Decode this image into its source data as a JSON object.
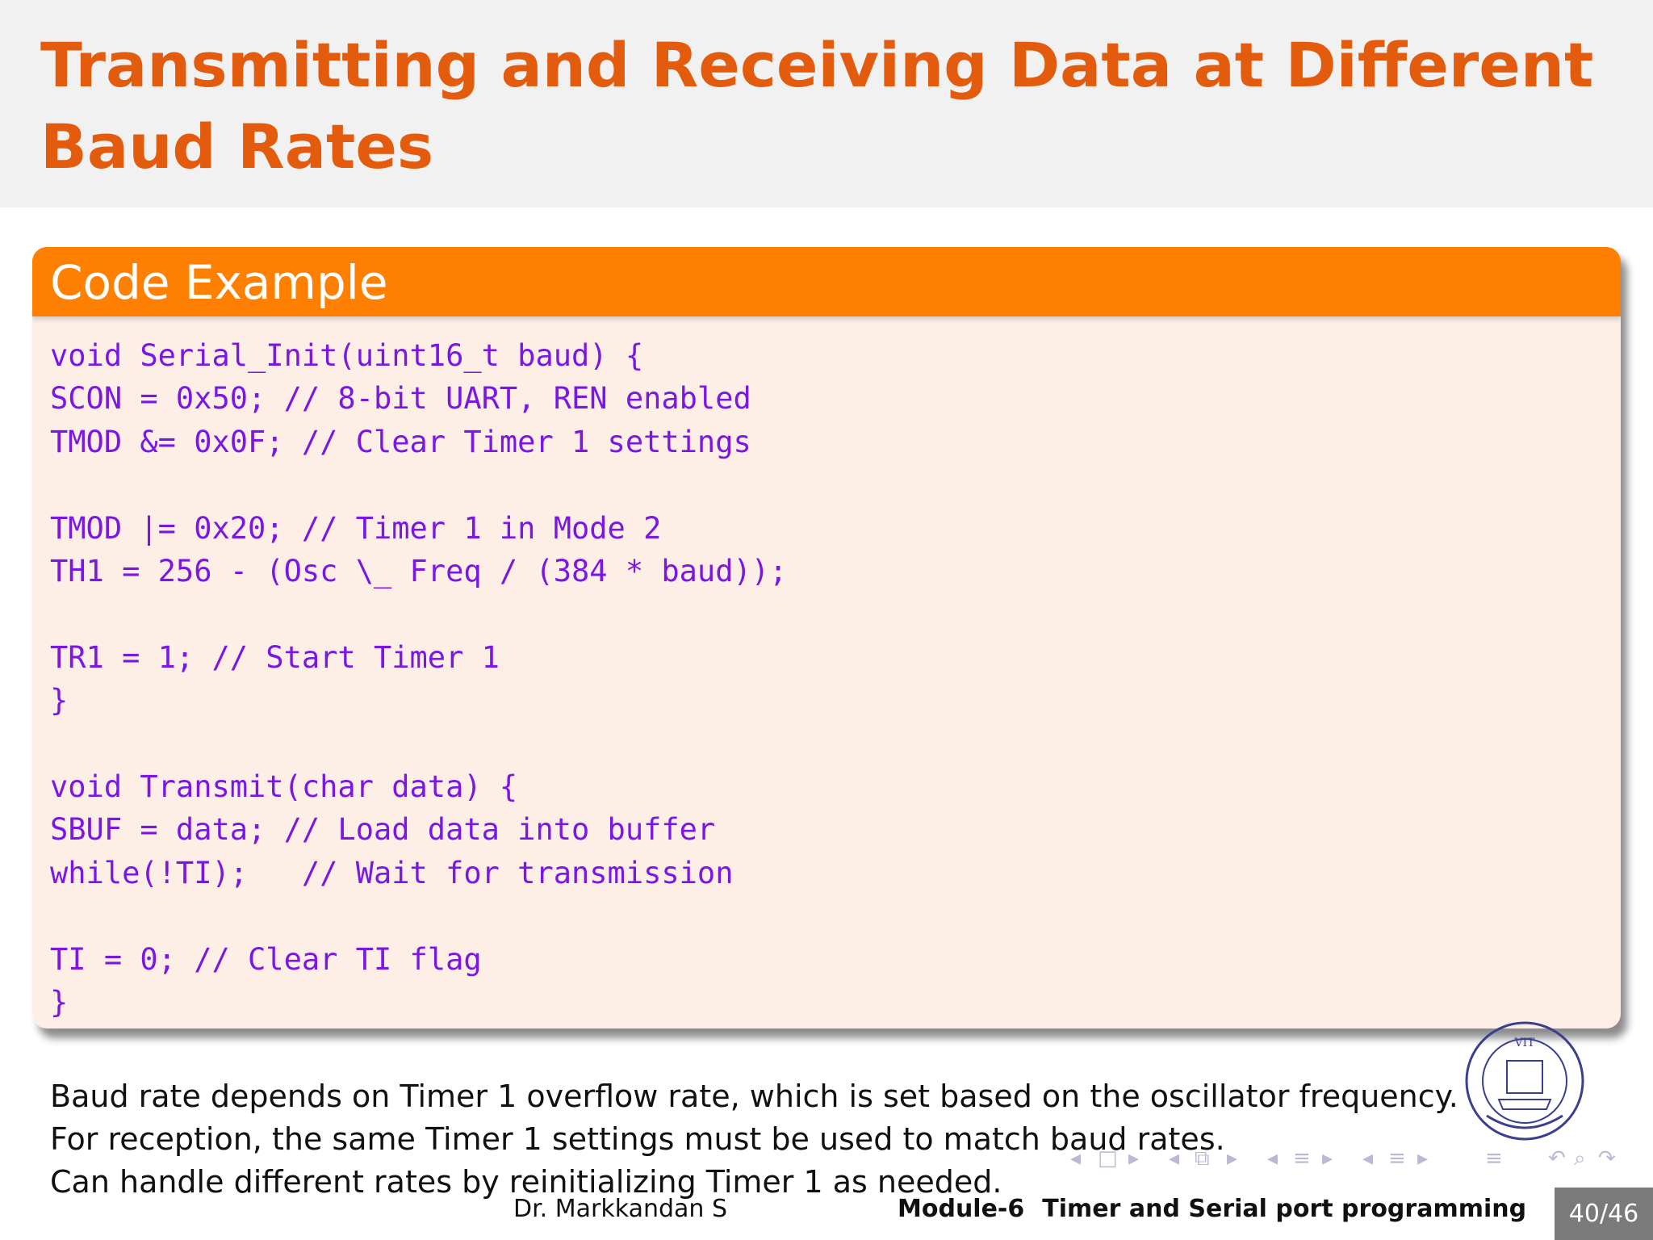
{
  "slide": {
    "title": "Transmitting and Receiving Data at Different Baud Rates"
  },
  "block": {
    "title": "Code Example",
    "code": "void Serial_Init(uint16_t baud) {\nSCON = 0x50; // 8-bit UART, REN enabled\nTMOD &= 0x0F; // Clear Timer 1 settings\n\nTMOD |= 0x20; // Timer 1 in Mode 2\nTH1 = 256 - (Osc \\_ Freq / (384 * baud));\n\nTR1 = 1; // Start Timer 1\n}\n\nvoid Transmit(char data) {\nSBUF = data; // Load data into buffer\nwhile(!TI);   // Wait for transmission\n\nTI = 0; // Clear TI flag\n}"
  },
  "notes": [
    "Baud rate depends on Timer 1 overflow rate, which is set based on the oscillator frequency.",
    "For reception, the same Timer 1 settings must be used to match baud rates.",
    "Can handle different rates by reinitializing Timer 1 as needed."
  ],
  "footer": {
    "author": "Dr. Markkandan S",
    "module": "Module-6",
    "topic": "Timer and Serial port programming",
    "page": "40/46"
  },
  "logo": {
    "text": "VELLORE INSTITUTE OF TECHNOLOGY",
    "initials": "VIT"
  },
  "colors": {
    "title": "#e35c0e",
    "block_header": "#ff8000",
    "block_body": "#fdefe6",
    "code": "#7a16e6",
    "title_bar": "#f1f1f1"
  }
}
